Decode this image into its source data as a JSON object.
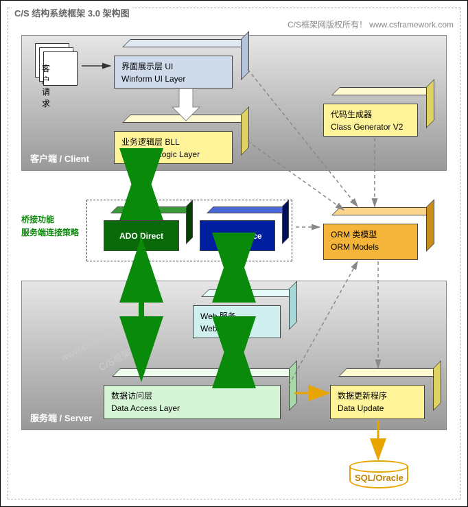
{
  "title": "C/S 结构系统框架 3.0 架构图",
  "copyright": "C/S框架网版权所有！ www.csframework.com",
  "client": {
    "label": "客户端  / Client",
    "request": "客户请求",
    "ui": {
      "zh": "界面展示层  UI",
      "en": "Winform UI Layer"
    },
    "bll": {
      "zh": "业务逻辑层  BLL",
      "en": "Business Logic Layer"
    },
    "gen": {
      "zh": "代码生成器",
      "en": "Class Generator V2"
    }
  },
  "bridge": {
    "label1": "桥接功能",
    "label2": "服务端连接策略",
    "ado": "ADO Direct",
    "ws": "Web Service"
  },
  "orm": {
    "zh": "ORM 类模型",
    "en": "ORM Models"
  },
  "server": {
    "label": "服务端  / Server",
    "web": {
      "zh": "Web 服务",
      "en": "Web Service"
    },
    "dal": {
      "zh": "数据访问层",
      "en": "Data Access Layer"
    },
    "upd": {
      "zh": "数据更新程序",
      "en": "Data Update"
    }
  },
  "db": "SQL/Oracle",
  "watermark1": "www.csframework.com",
  "watermark2": "C/S框架网"
}
